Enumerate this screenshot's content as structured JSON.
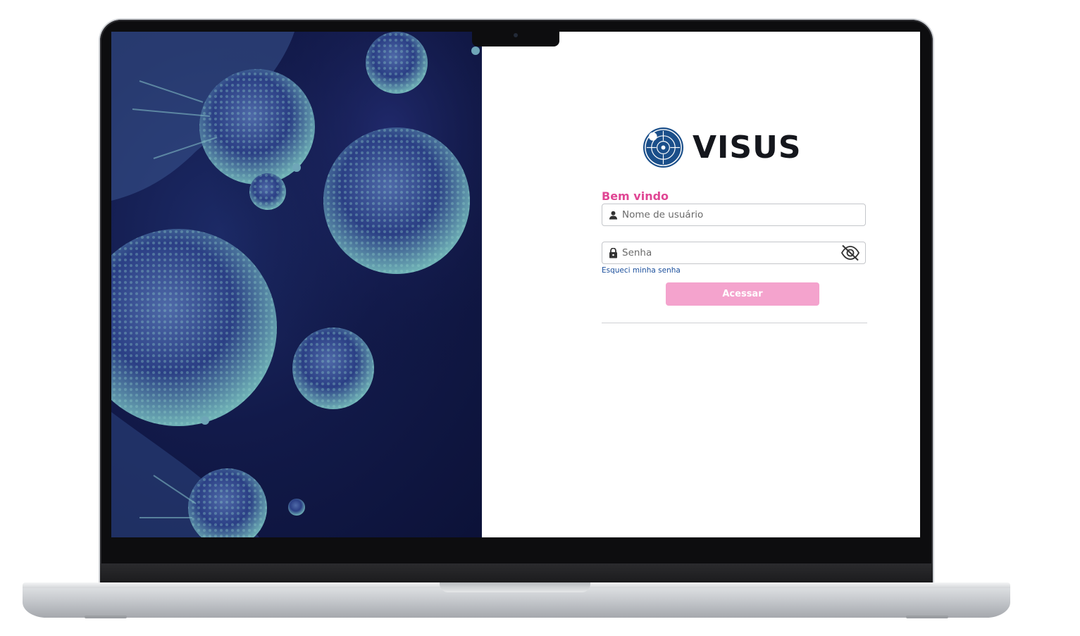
{
  "app": {
    "brand_name": "VISUS",
    "logo_icon": "crosshair-target-icon",
    "brand_color": "#1b4f8a",
    "accent_color": "#e04694"
  },
  "login": {
    "welcome_text": "Bem vindo",
    "username": {
      "placeholder": "Nome de usuário",
      "value": "",
      "icon": "user-icon"
    },
    "password": {
      "placeholder": "Senha",
      "value": "",
      "icon": "lock-icon",
      "toggle_icon": "eye-off-icon"
    },
    "forgot_link": "Esqueci minha senha",
    "submit_label": "Acessar",
    "submit_color": "#f4a3cd"
  },
  "hero": {
    "image_subject": "cancer-cells-illustration",
    "tint_color": "#121a4a"
  }
}
